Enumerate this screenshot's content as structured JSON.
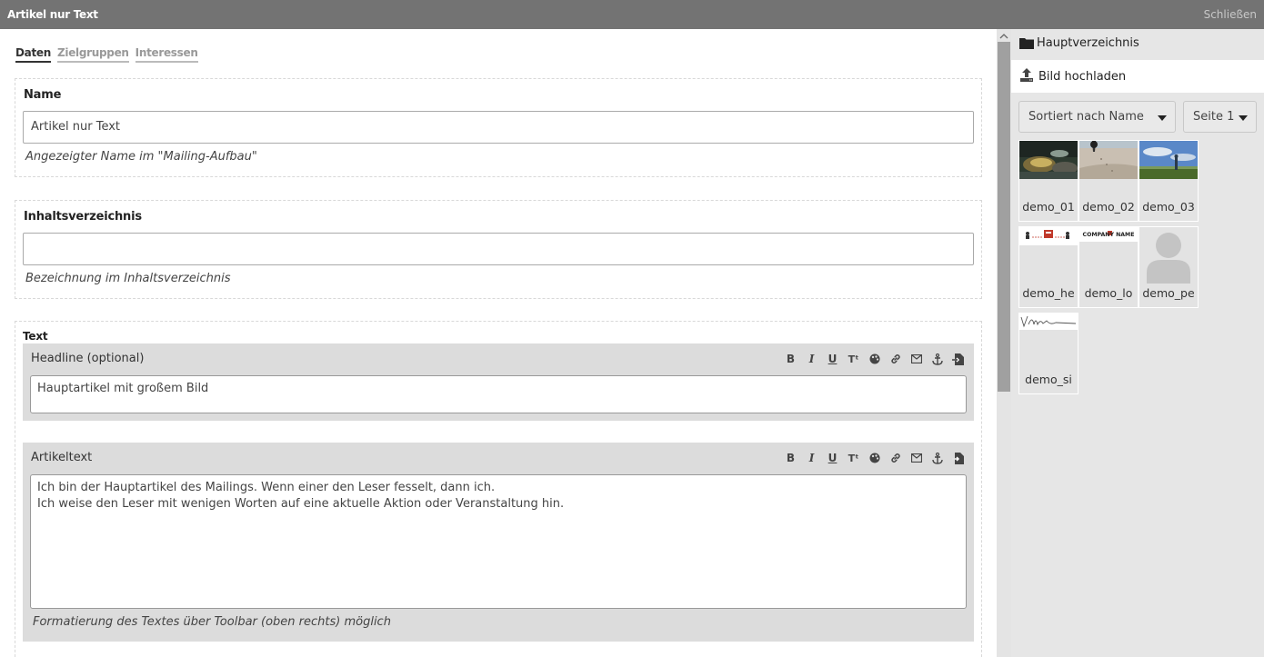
{
  "window": {
    "title": "Artikel nur Text",
    "close_label": "Schließen"
  },
  "tabs": [
    {
      "label": "Daten",
      "active": true
    },
    {
      "label": "Zielgruppen",
      "active": false
    },
    {
      "label": "Interessen",
      "active": false
    }
  ],
  "name_section": {
    "label": "Name",
    "value": "Artikel nur Text",
    "hint": "Angezeigter Name im \"Mailing-Aufbau\""
  },
  "toc_section": {
    "label": "Inhaltsverzeichnis",
    "value": "",
    "hint": "Bezeichnung im Inhaltsverzeichnis"
  },
  "text_section": {
    "label": "Text",
    "headline": {
      "label": "Headline (optional)",
      "value": "Hauptartikel mit großem Bild"
    },
    "body": {
      "label": "Artikeltext",
      "line1": "Ich bin der Hauptartikel des Mailings. Wenn einer den Leser fesselt, dann ich.",
      "line2": "Ich weise den Leser mit wenigen Worten auf eine aktuelle Aktion oder Veranstaltung hin.",
      "hint": "Formatierung des Textes über Toolbar (oben rechts) möglich"
    },
    "toolbar_icons": [
      "bold-icon",
      "italic-icon",
      "underline-icon",
      "font-size-icon",
      "palette-icon",
      "link-icon",
      "envelope-icon",
      "anchor-icon",
      "insert-icon"
    ]
  },
  "sidebar": {
    "folder_label": "Hauptverzeichnis",
    "upload_label": "Bild hochladen",
    "sort_select": "Sortiert nach Name",
    "page_select": "Seite 1",
    "images": [
      {
        "caption": "demo_01"
      },
      {
        "caption": "demo_02"
      },
      {
        "caption": "demo_03"
      },
      {
        "caption": "demo_he"
      },
      {
        "caption": "demo_lo",
        "logo_text": "COMPANY NAME"
      },
      {
        "caption": "demo_pe"
      },
      {
        "caption": "demo_si"
      }
    ]
  },
  "colors": {
    "titlebar": "#737373",
    "sidebar_bg": "#e6e6e6",
    "editor_bg": "#dcdcdc"
  }
}
